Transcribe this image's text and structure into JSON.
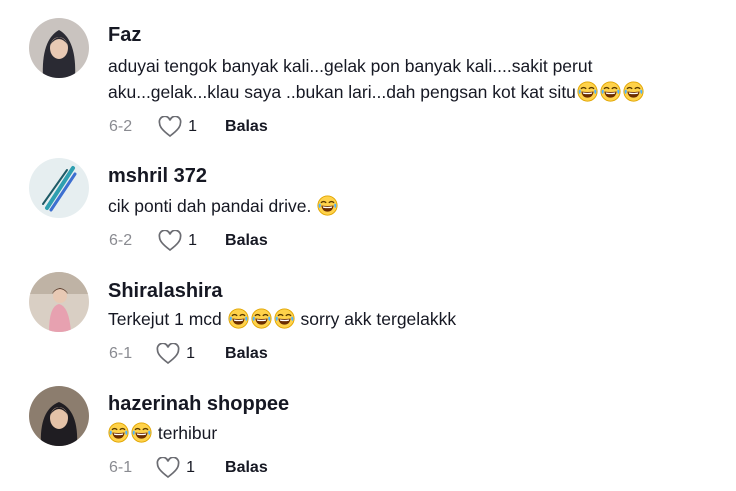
{
  "comments": [
    {
      "username": "Faz",
      "text_line1": "aduyai tengok banyak kali...gelak pon banyak kali....sakit perut",
      "text_line2": "aku...gelak...klau saya ..bukan lari...dah pengsan kot kat situ",
      "emoji_count": 3,
      "date": "6-2",
      "likes": "1",
      "reply_label": "Balas",
      "avatar_icon": "avatar-hijab-woman"
    },
    {
      "username": "mshril 372",
      "text": "cik ponti dah pandai drive.",
      "emoji_count": 1,
      "date": "6-2",
      "likes": "1",
      "reply_label": "Balas",
      "avatar_icon": "avatar-pens"
    },
    {
      "username": "Shiralashira",
      "text_before": "Terkejut 1 mcd",
      "text_after": "sorry akk tergelakkk",
      "emoji_count": 3,
      "date": "6-1",
      "likes": "1",
      "reply_label": "Balas",
      "avatar_icon": "avatar-woman-pink"
    },
    {
      "username": "hazerinah shoppee",
      "text": "terhibur",
      "emoji_count": 2,
      "date": "6-1",
      "likes": "1",
      "reply_label": "Balas",
      "avatar_icon": "avatar-hijab-dark"
    }
  ],
  "emoji_icon": "laughing-tears-emoji",
  "colors": {
    "meta_gray": "#8a8b91",
    "text": "#161823"
  }
}
